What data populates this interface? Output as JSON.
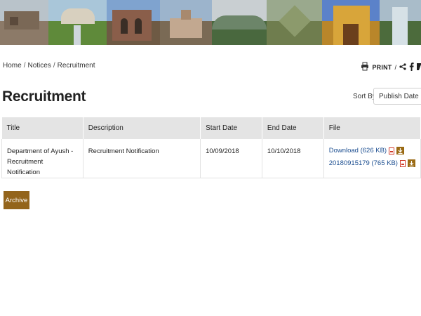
{
  "banner": {
    "images": [
      {
        "name": "banner-photo-stone-temple",
        "sky": "#b7c2c9",
        "land": "#8a7866"
      },
      {
        "name": "banner-photo-garden-palace",
        "sky": "#a9c6d9",
        "land": "#5f8a3a"
      },
      {
        "name": "banner-photo-gothic-ruin",
        "sky": "#7fa3cf",
        "land": "#6e5a44"
      },
      {
        "name": "banner-photo-hill-temple",
        "sky": "#9cb4cc",
        "land": "#7a6a55"
      },
      {
        "name": "banner-photo-misty-hills",
        "sky": "#c9cfd2",
        "land": "#49683e"
      },
      {
        "name": "banner-photo-star-fort",
        "sky": "#9aa98d",
        "land": "#6f7d4e"
      },
      {
        "name": "banner-photo-gopuram",
        "sky": "#5b82c9",
        "land": "#b9862a"
      },
      {
        "name": "banner-photo-waterfall",
        "sky": "#a9bcc9",
        "land": "#4c6b3c"
      }
    ]
  },
  "breadcrumb": {
    "home": "Home",
    "notices": "Notices",
    "current": "Recruitment",
    "sep": "/"
  },
  "utility": {
    "print_label": "PRINT",
    "sep": "/"
  },
  "page_title": "Recruitment",
  "sort": {
    "label": "Sort By:",
    "selected": "Publish Date"
  },
  "table": {
    "headers": {
      "title": "Title",
      "description": "Description",
      "start": "Start Date",
      "end": "End Date",
      "file": "File"
    },
    "rows": [
      {
        "title": "Department of Ayush - Recruitment Notification",
        "description": "Recruitment Notification",
        "start": "10/09/2018",
        "end": "10/10/2018",
        "files": [
          {
            "label": "Download (626 KB)"
          },
          {
            "label": "20180915179 (765 KB)"
          }
        ]
      }
    ]
  },
  "archive_label": "Archive",
  "colors": {
    "accent": "#93641b",
    "link": "#1d4f91",
    "header_bg": "#e4e4e4"
  }
}
